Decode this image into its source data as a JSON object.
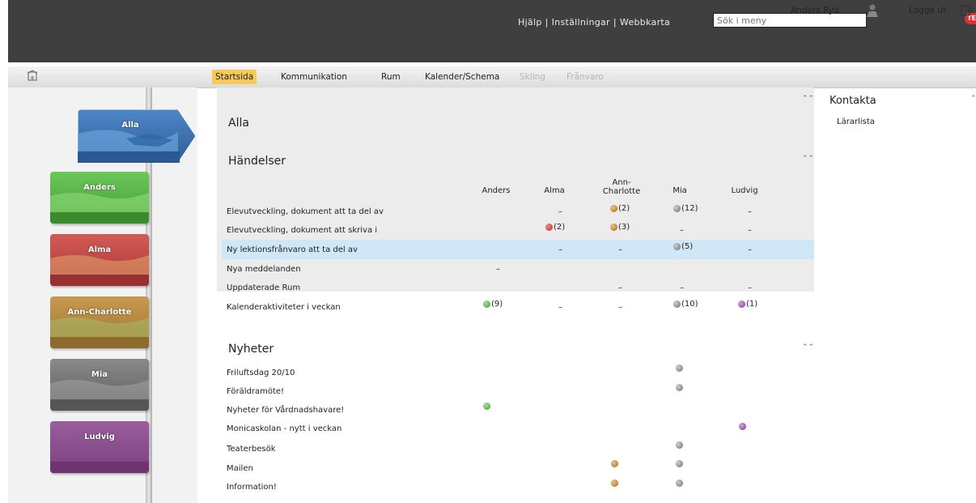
{
  "topbar": {
    "links": [
      "Hjälp",
      "Inställningar",
      "Webbkarta"
    ],
    "search_placeholder": "Sök i meny",
    "badge": "TE"
  },
  "nav": {
    "tabs": [
      {
        "label": "Startsida",
        "active": true
      },
      {
        "label": "Kommunikation"
      },
      {
        "label": "Rum"
      },
      {
        "label": "Kalender/Schema"
      },
      {
        "label": "Skling",
        "faded": true
      },
      {
        "label": "Frånvaro",
        "faded": true
      }
    ],
    "user_name": "Anders Ryd",
    "logout": "Logga ut"
  },
  "students": [
    {
      "name": "Alla",
      "color": "#3b6fb0"
    },
    {
      "name": "Anders",
      "color": "#5cb84a"
    },
    {
      "name": "Alma",
      "color": "#c04848"
    },
    {
      "name": "Ann-Charlotte",
      "color": "#b88a3e"
    },
    {
      "name": "Mia",
      "color": "#7a7a7a"
    },
    {
      "name": "Ludvig",
      "color": "#8a4f8e"
    }
  ],
  "main": {
    "heading": "Alla",
    "events_title": "Händelser",
    "columns": [
      "Anders",
      "Alma",
      "Ann-\nCharlotte",
      "Mia",
      "Ludvig"
    ],
    "rows": [
      {
        "label": "Elevutveckling, dokument att ta del av",
        "cells": [
          "",
          "–",
          "(2)",
          "(12)",
          "–"
        ]
      },
      {
        "label": "Elevutveckling, dokument att skriva i",
        "cells": [
          "",
          "(2)",
          "(3)",
          "–",
          "–"
        ]
      },
      {
        "label": "Ny lektionsfrånvaro att ta del av",
        "cells": [
          "",
          "–",
          "–",
          "(5)",
          "–"
        ]
      },
      {
        "label": "Nya meddelanden",
        "cells": [
          "–",
          "",
          "",
          "",
          ""
        ]
      },
      {
        "label": "Uppdaterade Rum",
        "cells": [
          "",
          "",
          "–",
          "–",
          "–"
        ]
      },
      {
        "label": "Kalenderaktiviteter i veckan",
        "cells": [
          "(9)",
          "–",
          "–",
          "(10)",
          "(1)"
        ]
      }
    ],
    "news_title": "Nyheter",
    "news": [
      {
        "label": "Friluftsdag 20/10"
      },
      {
        "label": "Föräldramöte!"
      },
      {
        "label": "Nyheter för Vårdnadshavare!"
      },
      {
        "label": "Monicaskolan - nytt i veckan"
      },
      {
        "label": "Teaterbesök"
      },
      {
        "label": "Mailen"
      },
      {
        "label": "Information!"
      }
    ]
  },
  "side": {
    "kontakta_title": "Kontakta",
    "kontakta_link": "Lärarlista"
  },
  "icons": {
    "home": "home-icon",
    "collapse": "collapse-arrow-icon",
    "user": "user-icon",
    "logout": "logout-icon",
    "dot": "status-dot-icon"
  }
}
